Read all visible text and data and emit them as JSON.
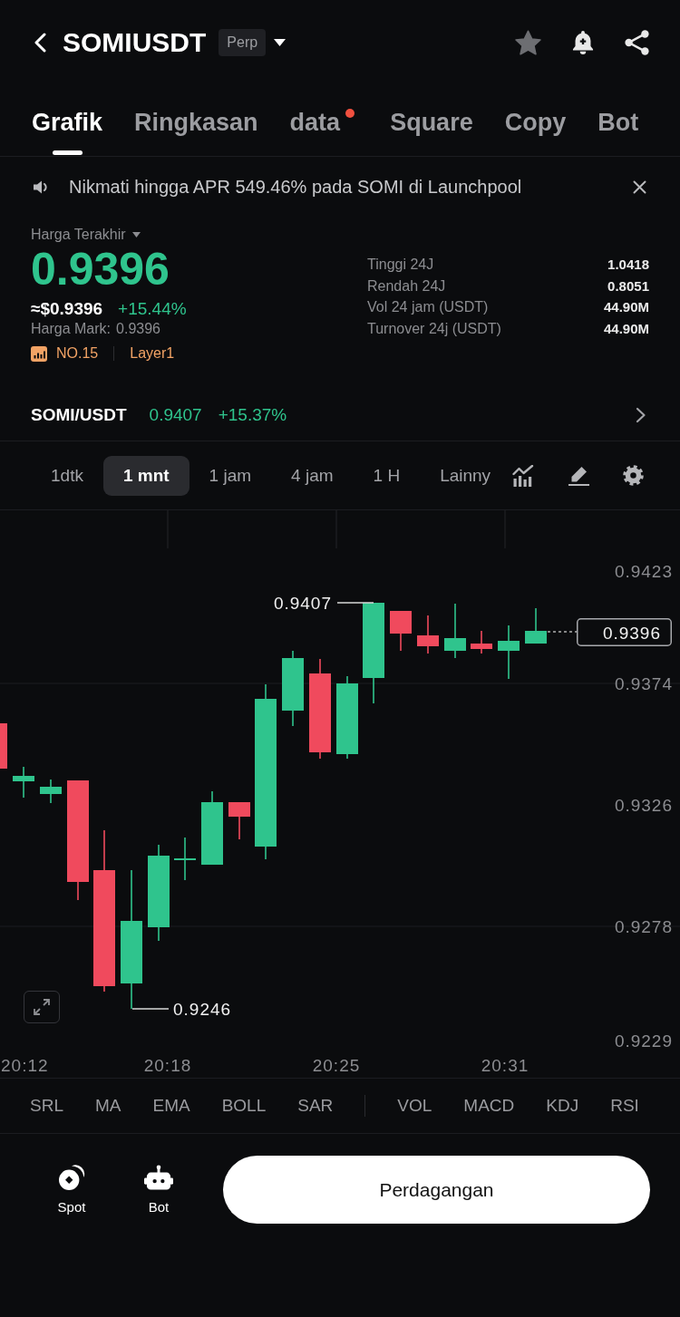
{
  "header": {
    "symbol": "SOMIUSDT",
    "badge": "Perp"
  },
  "tabs": [
    {
      "label": "Grafik",
      "selected": true,
      "notification": false
    },
    {
      "label": "Ringkasan",
      "selected": false,
      "notification": false
    },
    {
      "label": "data",
      "selected": false,
      "notification": true
    },
    {
      "label": "Square",
      "selected": false,
      "notification": false
    },
    {
      "label": "Copy",
      "selected": false,
      "notification": false
    },
    {
      "label": "Bot",
      "selected": false,
      "notification": false
    }
  ],
  "announcement": {
    "text": "Nikmati hingga APR 549.46% pada SOMI di Launchpool"
  },
  "ticker": {
    "price_label": "Harga Terakhir",
    "last_price": "0.9396",
    "usd_price": "≈$0.9396",
    "change": "+15.44%",
    "mark_label": "Harga Mark:",
    "mark_price": "0.9396",
    "rank": "NO.15",
    "sector": "Layer1",
    "stats": [
      {
        "label": "Tinggi 24J",
        "value": "1.0418"
      },
      {
        "label": "Rendah 24J",
        "value": "0.8051"
      },
      {
        "label": "Vol 24 jam (USDT)",
        "value": "44.90M"
      },
      {
        "label": "Turnover 24j (USDT)",
        "value": "44.90M"
      }
    ]
  },
  "spot_pair": {
    "symbol": "SOMI/USDT",
    "price": "0.9407",
    "change": "+15.37%"
  },
  "intervals": [
    {
      "label": "1dtk",
      "selected": false
    },
    {
      "label": "1 mnt",
      "selected": true
    },
    {
      "label": "1 jam",
      "selected": false
    },
    {
      "label": "4 jam",
      "selected": false
    },
    {
      "label": "1 H",
      "selected": false
    },
    {
      "label": "Lainny",
      "selected": false
    }
  ],
  "chart": {
    "price_axis": [
      "0.9423",
      "0.9374",
      "0.9326",
      "0.9278",
      "0.9229"
    ],
    "time_axis": [
      "20:12",
      "20:18",
      "20:25",
      "20:31"
    ],
    "high_label": "0.9407",
    "low_label": "0.9246",
    "last_price_tag": "0.9396"
  },
  "indicators": {
    "main": [
      "SRL",
      "MA",
      "EMA",
      "BOLL",
      "SAR"
    ],
    "sub": [
      "VOL",
      "MACD",
      "KDJ",
      "RSI"
    ]
  },
  "bottom_bar": {
    "shortcuts": [
      {
        "label": "Spot"
      },
      {
        "label": "Bot"
      }
    ],
    "trade_button": "Perdagangan"
  }
}
